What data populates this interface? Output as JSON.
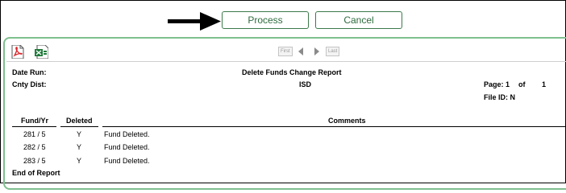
{
  "actions": {
    "process_label": "Process",
    "cancel_label": "Cancel"
  },
  "pager": {
    "first": "First",
    "last": "Last"
  },
  "report": {
    "date_run_label": "Date Run:",
    "cnty_dist_label": "Cnty Dist:",
    "title": "Delete Funds Change Report",
    "district": "ISD",
    "page_label": "Page:",
    "page_num": "1",
    "of_label": "of",
    "page_total": "1",
    "file_id": "File ID: N",
    "columns": {
      "fund_yr": "Fund/Yr",
      "deleted": "Deleted",
      "comments": "Comments"
    },
    "rows": [
      {
        "fund_yr": "281 / 5",
        "deleted": "Y",
        "comment": "Fund Deleted."
      },
      {
        "fund_yr": "282 / 5",
        "deleted": "Y",
        "comment": "Fund Deleted."
      },
      {
        "fund_yr": "283 / 5",
        "deleted": "Y",
        "comment": "Fund Deleted."
      }
    ],
    "footer": "End of Report"
  },
  "icons": {
    "pointer": "arrow-pointer-icon",
    "pdf": "pdf-export-icon",
    "excel": "excel-export-icon"
  },
  "colors": {
    "button_border": "#3b7a4a",
    "button_text": "#2e6b3e",
    "panel_border": "#7fbf8f"
  }
}
